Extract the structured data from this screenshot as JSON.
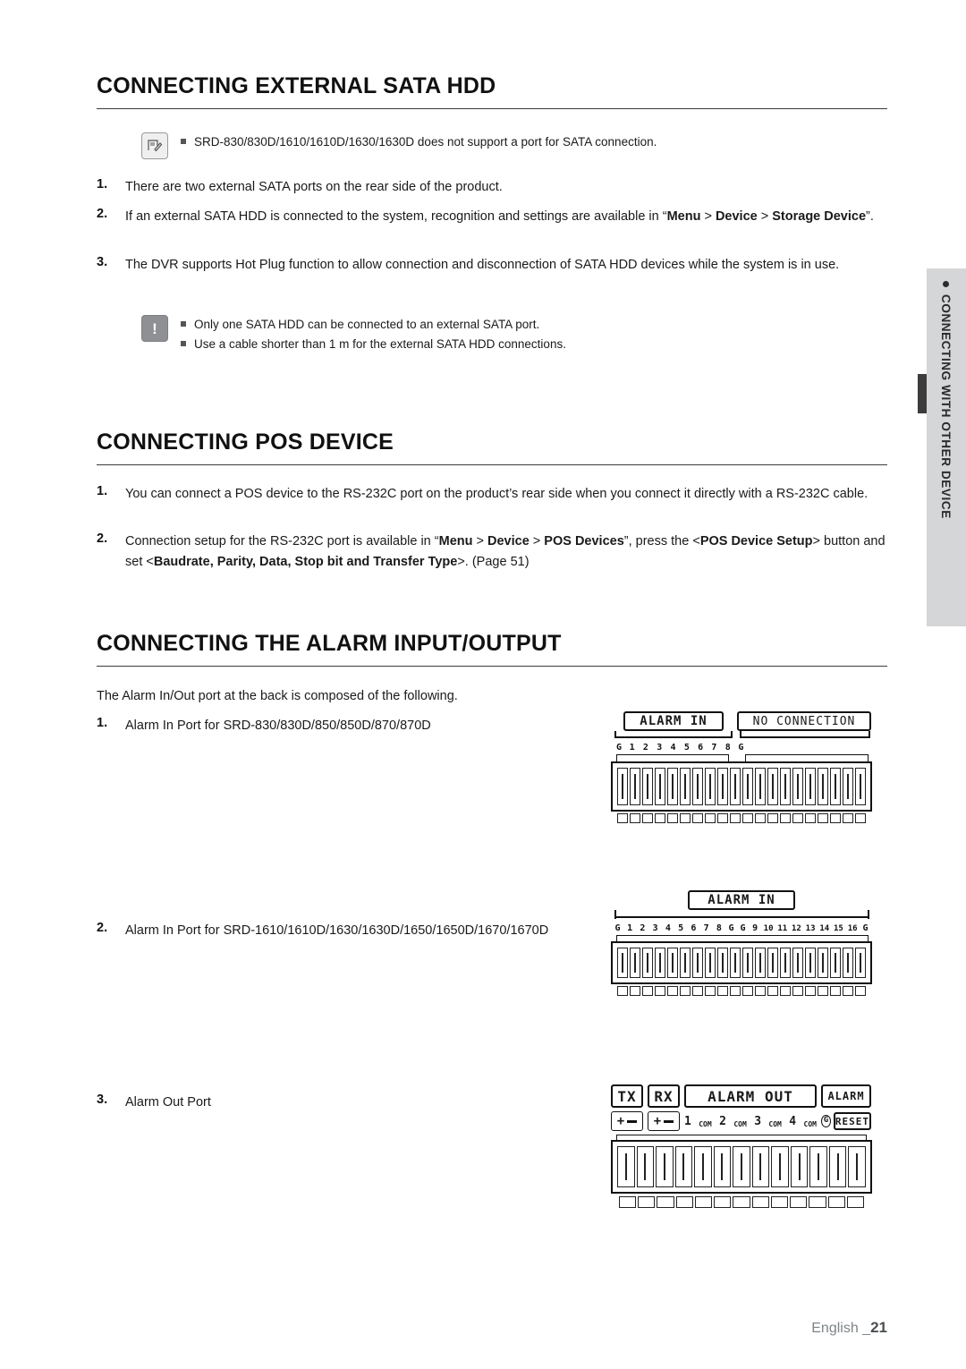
{
  "sidetab": {
    "label": "CONNECTING WITH OTHER DEVICE"
  },
  "sections": {
    "sata": {
      "title": "CONNECTING EXTERNAL SATA HDD",
      "note1": "SRD-830/830D/1610/1610D/1630/1630D does not support a port for SATA connection.",
      "items": [
        {
          "num": "1.",
          "text": "There are two external SATA ports on the rear side of the product."
        },
        {
          "num": "2.",
          "text": "If an external SATA HDD is connected to the system, recognition and settings are available in “Menu > Device > Storage Device”."
        },
        {
          "num": "3.",
          "text": "The DVR supports Hot Plug function to allow connection and disconnection of SATA HDD devices while the system is in use."
        }
      ],
      "caution": [
        "Only one SATA HDD can be connected to an external SATA port.",
        "Use a cable shorter than 1 m for the external SATA HDD connections."
      ]
    },
    "pos": {
      "title": "CONNECTING POS DEVICE",
      "items": [
        {
          "num": "1.",
          "text": "You can connect a POS device to the RS-232C port on the product’s rear side when you connect it directly with a RS-232C cable."
        },
        {
          "num": "2.",
          "text": "Connection setup for the RS-232C port is available in “Menu > Device > POS Devices”, press the <POS Device Setup> button and set <Baudrate, Parity, Data, Stop bit and Transfer Type>. (Page 51)"
        }
      ]
    },
    "alarm": {
      "title": "CONNECTING THE ALARM INPUT/OUTPUT",
      "intro": "The Alarm In/Out port at the back is composed of the following.",
      "items": [
        {
          "num": "1.",
          "text": "Alarm In Port for SRD-830/830D/850/850D/870/870D"
        },
        {
          "num": "2.",
          "text": "Alarm In Port for SRD-1610/1610D/1630/1630D/1650/1650D/1670/1670D"
        },
        {
          "num": "3.",
          "text": "Alarm Out Port"
        }
      ]
    }
  },
  "diagrams": {
    "alarm_in_8": {
      "label_left": "ALARM IN",
      "label_right": "NO CONNECTION",
      "pins": [
        "G",
        "1",
        "2",
        "3",
        "4",
        "5",
        "6",
        "7",
        "8",
        "G"
      ]
    },
    "alarm_in_16": {
      "label": "ALARM IN",
      "pins": [
        "G",
        "1",
        "2",
        "3",
        "4",
        "5",
        "6",
        "7",
        "8",
        "G",
        "G",
        "9",
        "10",
        "11",
        "12",
        "13",
        "14",
        "15",
        "16",
        "G"
      ]
    },
    "alarm_out": {
      "tx": "TX",
      "rx": "RX",
      "label": "ALARM OUT",
      "alarm": "ALARM",
      "reset": "RESET",
      "pins": [
        "+",
        "-",
        "+",
        "-",
        "1",
        "COM",
        "2",
        "COM",
        "3",
        "COM",
        "4",
        "COM",
        "G"
      ]
    }
  },
  "footer": {
    "lang": "English _",
    "page": "21"
  }
}
